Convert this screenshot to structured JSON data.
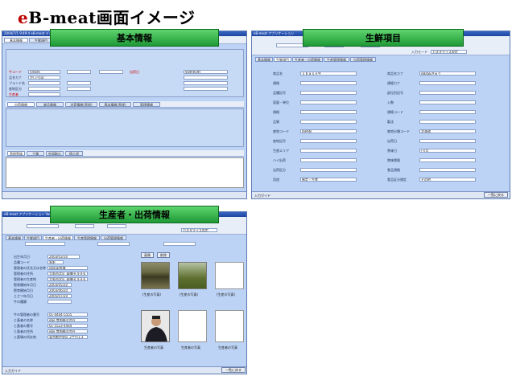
{
  "title_brand": "e",
  "title_rest": "B-meat画面イメージ",
  "win1": {
    "titlebar": "2004/7/1 9:49:4 eB-meat デキ/トド  アプリケーション",
    "band": "基本情報",
    "tabs": [
      "基本情報",
      "生鮮項目",
      "生産者・出荷情報",
      "鮮度管理",
      "保管情報",
      "受注情報",
      "品質情報"
    ],
    "fields": [
      "牛コード",
      "品名カナ",
      "ブランド名",
      "産地区分",
      "生産者",
      "出荷日"
    ],
    "values": [
      "nmbfe",
      "かいべ(g)"
    ],
    "right_label": "処理(処理)",
    "sub_tabs": [
      "出荷情報",
      "商品情報",
      "出荷情報(直接)",
      "基本情報(直接)",
      "管理情報"
    ],
    "grid_tabs": [
      "直接登録",
      "工場",
      "外部取込",
      "個人設"
    ]
  },
  "win2": {
    "titlebar": "eB-meat アプリケーション",
    "band": "生鮮項目",
    "tabs": [
      "基本情報",
      "生鮮項目",
      "生産者・出荷情報",
      "生産管理情報",
      "出荷管理情報"
    ],
    "mode_label": "入力モード",
    "mode_value": "カスタマイズ設定",
    "left_labels": [
      "商品名",
      "規格",
      "品種記号",
      "容量・単位",
      "規格",
      "品質",
      "産地コード",
      "産地記号",
      "生産エリア",
      "ハイ出荷",
      "出荷区分",
      "用途"
    ],
    "left_values": [
      "ｓｂａｓｅ牛",
      "",
      "",
      "",
      "",
      "",
      "JAPAN",
      "",
      "",
      "",
      "",
      "制定・生産"
    ],
    "right_labels": [
      "商品名カナ",
      "規格カナ",
      "部位別記号",
      "入数",
      "規格コード",
      "製法",
      "産地分類コード",
      "出荷日",
      "賞味日",
      "賞味期限",
      "食品規格",
      "食品区分規定"
    ],
    "right_values": [
      "eBaSEぎゅう",
      "",
      "",
      "",
      "",
      "",
      "北海道",
      "",
      "日/月",
      "",
      "",
      "その他"
    ],
    "status": "入力ガイド",
    "close": "一覧に戻る"
  },
  "win3": {
    "titlebar": "eB-meat アプリケーション Version 1",
    "band": "生産者・出荷情報",
    "tabs": [
      "基本情報",
      "生鮮項目",
      "生産者・出荷情報",
      "生産管理情報",
      "出荷管理情報"
    ],
    "labels": [
      "出生年月日",
      "品種コード",
      "管理者の氏名又は名称",
      "管理者の住所",
      "管理者の生産地",
      "肥育開始年月日",
      "肥育開始月日",
      "とさつ年月日",
      "牛の種類",
      "牛の管理者の番号",
      "と畜者の名称",
      "と畜者の番号",
      "と畜者の住所",
      "と畜場の所在地"
    ],
    "values": [
      "2003/03/10",
      "黒毛",
      "ebaSE牧場",
      "大阪市北区 東梅田 4-4-6",
      "大阪市北区 東梅田 4-4-6",
      "2003/05/20",
      "2003/06/20",
      "2005/07/20",
      "",
      "01-4444-5555",
      "ebe 食肉株式会社",
      "01-5523-4444",
      "ebe 食肉株式会社",
      "東京都中央区 2丁目1-3"
    ],
    "photo_buttons": [
      "画像",
      "削除"
    ],
    "captions": [
      "(生産の写真)",
      "(生産の写真)",
      "(生産の写真)",
      "生産者の写真",
      "生産者の写真",
      "生産者の写真"
    ],
    "status": "入力ガイド",
    "close": "一覧に戻る"
  }
}
